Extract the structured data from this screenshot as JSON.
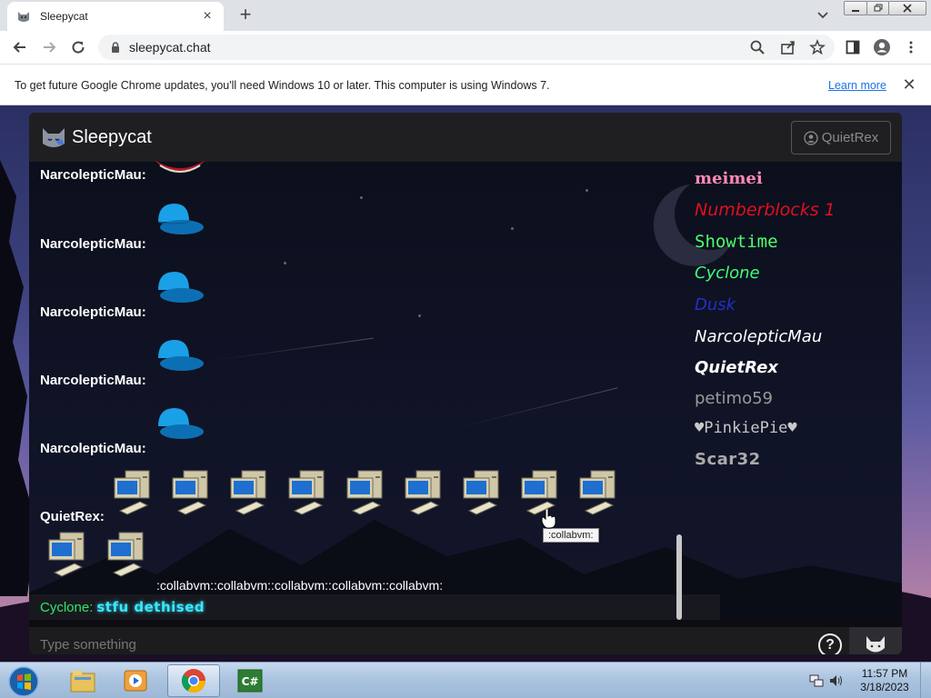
{
  "browser": {
    "tab_title": "Sleepycat",
    "url": "sleepycat.chat",
    "infobar_message": "To get future Google Chrome updates, you'll need Windows 10 or later. This computer is using Windows 7.",
    "infobar_link": "Learn more"
  },
  "app": {
    "title": "Sleepycat",
    "current_user": "QuietRex",
    "input_placeholder": "Type something"
  },
  "chat": {
    "messages": [
      {
        "sender": "NarcolepticMau:",
        "content_icon": "red-object-icon"
      },
      {
        "sender": "NarcolepticMau:",
        "content_icon": "blue-cap-icon"
      },
      {
        "sender": "NarcolepticMau:",
        "content_icon": "blue-cap-icon"
      },
      {
        "sender": "NarcolepticMau:",
        "content_icon": "blue-cap-icon"
      },
      {
        "sender": "NarcolepticMau:",
        "content_icon": "blue-cap-icon"
      },
      {
        "sender": "QuietRex:",
        "content_icon": "computer-icon",
        "icon_count": 11
      },
      {
        "sender": "Cyclone:",
        "text": "stfu dethised"
      }
    ],
    "emoji_text": ":collabvm::collabvm::collabvm::collabvm::collabvm:",
    "tooltip": ":collabvm:"
  },
  "users": [
    "meimei",
    "Numberblocks 1",
    "Showtime",
    "Cyclone",
    "Dusk",
    "NarcolepticMau",
    "QuietRex",
    "petimo59",
    "♥PinkiePie♥",
    "Scar32"
  ],
  "taskbar": {
    "apps": [
      "explorer-icon",
      "media-player-icon",
      "chrome-icon",
      "csharp-icon"
    ],
    "time": "11:57 PM",
    "date": "3/18/2023"
  },
  "colors": {
    "accent_green": "#2ee66e",
    "cyan_text": "#38e8ff",
    "chrome_link": "#1a73e8"
  }
}
